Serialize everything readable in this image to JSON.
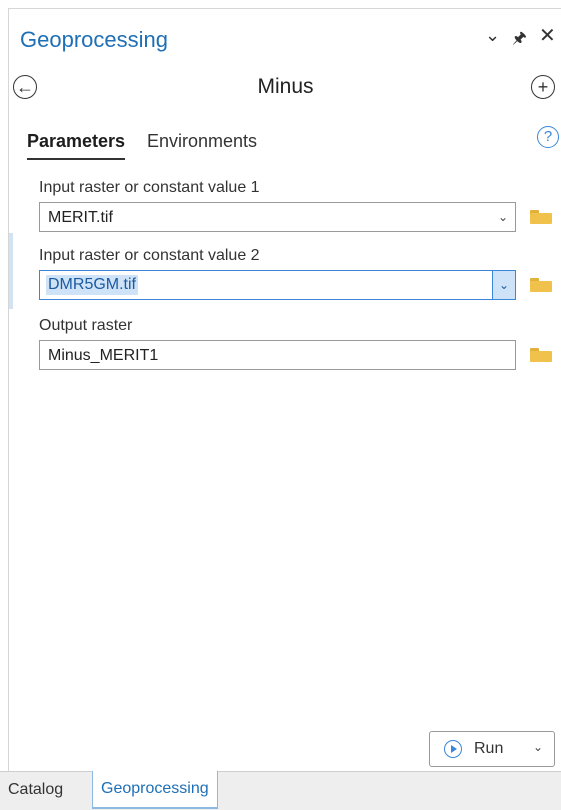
{
  "header": {
    "title": "Geoprocessing",
    "controls": [
      "chevron-down-icon",
      "pin-icon",
      "close-icon"
    ]
  },
  "nav": {
    "tool_name": "Minus",
    "back_icon": "back-arrow-circle-icon",
    "add_icon": "plus-circle-icon"
  },
  "tabs": [
    {
      "label": "Parameters",
      "active": true
    },
    {
      "label": "Environments",
      "active": false
    }
  ],
  "help_icon": "question-circle-icon",
  "parameters": [
    {
      "label": "Input raster or constant value 1",
      "value": "MERIT.tif",
      "has_dropdown": true,
      "focused": false
    },
    {
      "label": "Input raster or constant value 2",
      "value": "DMR5GM.tif",
      "has_dropdown": true,
      "focused": true
    },
    {
      "label": "Output raster",
      "value": "Minus_MERIT1",
      "has_dropdown": false,
      "focused": false
    }
  ],
  "run_button": {
    "label": "Run"
  },
  "bottom_tabs": [
    {
      "label": "Catalog",
      "active": false
    },
    {
      "label": "Geoprocessing",
      "active": true
    }
  ],
  "colors": {
    "accent": "#1e6fb5",
    "selection": "#cfe3f8",
    "folder": "#f0c24c",
    "help": "#3b86d8"
  }
}
